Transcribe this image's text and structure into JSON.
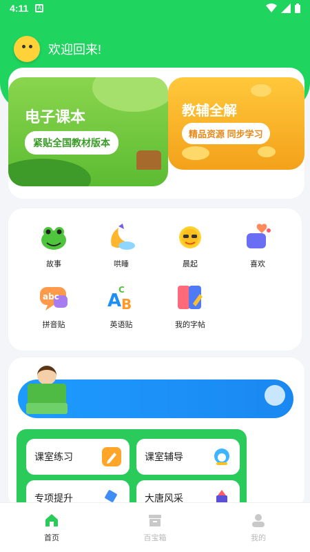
{
  "status_bar": {
    "time": "4:11",
    "app_indicator": "A"
  },
  "header": {
    "welcome": "欢迎回来!"
  },
  "banners": [
    {
      "title": "电子课本",
      "subtitle": "紧贴全国教材版本"
    },
    {
      "title": "教辅全解",
      "subtitle": "精品资源 同步学习"
    }
  ],
  "grid": [
    {
      "label": "故事",
      "icon": "frog-icon"
    },
    {
      "label": "哄睡",
      "icon": "moon-icon"
    },
    {
      "label": "晨起",
      "icon": "sun-icon"
    },
    {
      "label": "喜欢",
      "icon": "heart-box-icon"
    },
    {
      "label": "拼音贴",
      "icon": "abc-bubble-icon"
    },
    {
      "label": "英语贴",
      "icon": "abc-letters-icon"
    },
    {
      "label": "我的字帖",
      "icon": "notebook-icon"
    }
  ],
  "practice": [
    {
      "label": "课室练习",
      "icon": "pencil-icon"
    },
    {
      "label": "课室辅导",
      "icon": "tutor-icon"
    },
    {
      "label": "专项提升",
      "icon": "flag-icon"
    },
    {
      "label": "大唐风采",
      "icon": "castle-icon"
    }
  ],
  "tabbar": [
    {
      "label": "首页",
      "icon": "home-icon",
      "active": true
    },
    {
      "label": "百宝箱",
      "icon": "box-icon",
      "active": false
    },
    {
      "label": "我的",
      "icon": "user-icon",
      "active": false
    }
  ],
  "colors": {
    "brand_green": "#1fd45f",
    "accent_orange": "#f3a11b",
    "accent_blue": "#1e9bff"
  }
}
